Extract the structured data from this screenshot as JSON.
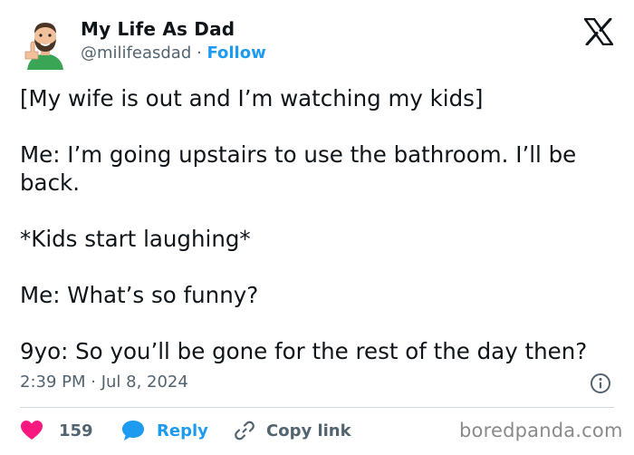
{
  "author": {
    "display_name": "My Life As Dad",
    "handle": "@milifeasdad",
    "separator": "·",
    "follow_label": "Follow",
    "avatar_icon": "cartoon-dad-avatar"
  },
  "tweet": {
    "paragraphs": [
      "[My wife is out and I’m watching my kids]",
      "Me: I’m going upstairs to use the bathroom. I’ll be back.",
      "*Kids start laughing*",
      "Me: What’s so funny?",
      "9yo: So you’ll be gone for the rest of the day then?"
    ],
    "timestamp": "2:39 PM · Jul 8, 2024"
  },
  "actions": {
    "like_count": "159",
    "reply_label": "Reply",
    "copy_link_label": "Copy link"
  },
  "icons": {
    "platform": "x-logo-icon",
    "info": "info-icon",
    "like": "heart-icon",
    "reply": "speech-bubble-icon",
    "copy": "link-icon"
  },
  "colors": {
    "text": "#0f1419",
    "secondary": "#536471",
    "accent": "#1d9bf0",
    "like": "#f91880",
    "divider": "#cfd9de"
  },
  "watermark": "boredpanda.com"
}
